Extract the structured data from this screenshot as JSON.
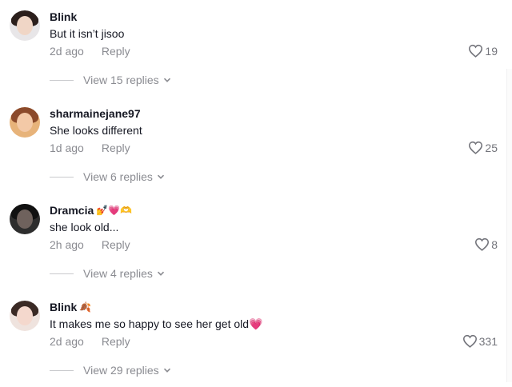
{
  "comments": [
    {
      "username": "Blink",
      "emojis": "",
      "text": "But it isn’t jisoo",
      "time": "2d ago",
      "reply_label": "Reply",
      "likes": "19",
      "view_replies": "View 15 replies",
      "avatar_icon": "profile-photo"
    },
    {
      "username": "sharmainejane97",
      "emojis": "",
      "text": "She looks different",
      "time": "1d ago",
      "reply_label": "Reply",
      "likes": "25",
      "view_replies": "View 6 replies",
      "avatar_icon": "profile-photo"
    },
    {
      "username": "Dramcia",
      "emojis": "💅💗🫶",
      "text": "she look old...",
      "time": "2h ago",
      "reply_label": "Reply",
      "likes": "8",
      "view_replies": "View 4 replies",
      "avatar_icon": "profile-photo"
    },
    {
      "username": "Blink",
      "emojis": "🍂",
      "text": "It makes me so happy to see her get old💗",
      "time": "2d ago",
      "reply_label": "Reply",
      "likes": "331",
      "view_replies": "View 29 replies",
      "avatar_icon": "profile-photo"
    }
  ],
  "colors": {
    "text_primary": "#161823",
    "text_secondary": "#8a8b91",
    "divider": "#c9cacd"
  }
}
